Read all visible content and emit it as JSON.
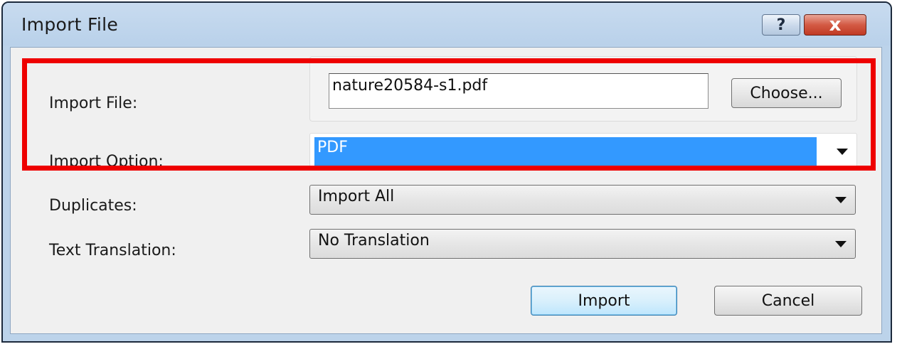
{
  "window": {
    "title": "Import File",
    "help_icon": "?",
    "close_icon": "x"
  },
  "form": {
    "import_file_label": "Import File:",
    "import_file_value": "nature20584-s1.pdf",
    "choose_label": "Choose...",
    "import_option_label": "Import Option:",
    "import_option_value": "PDF",
    "duplicates_label": "Duplicates:",
    "duplicates_value": "Import All",
    "text_translation_label": "Text Translation:",
    "text_translation_value": "No Translation"
  },
  "buttons": {
    "import_label": "Import",
    "cancel_label": "Cancel"
  },
  "colors": {
    "highlight": "#ee0000",
    "selection": "#3399ff",
    "close_button": "#c13a24"
  }
}
